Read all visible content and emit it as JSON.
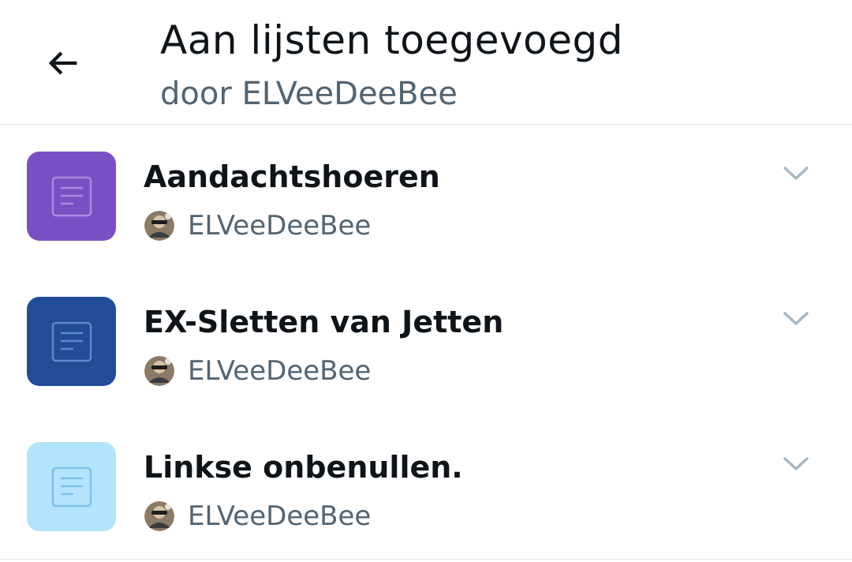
{
  "header": {
    "back_icon": "arrow-left-icon",
    "title": "Aan lijsten toegevoegd",
    "subtitle": "door ELVeeDeeBee"
  },
  "lists": [
    {
      "name": "Aandachtshoeren",
      "owner": "ELVeeDeeBee",
      "tile_color": "#7b4fc4",
      "icon_color": "#a98be0",
      "icon": "list-document-icon"
    },
    {
      "name": "EX-Sletten van Jetten",
      "owner": "ELVeeDeeBee",
      "tile_color": "#204d96",
      "icon_color": "#5b86cc",
      "icon": "list-document-icon"
    },
    {
      "name": "Linkse onbenullen.",
      "owner": "ELVeeDeeBee",
      "tile_color": "#b3e4fb",
      "icon_color": "#7ec2ea",
      "icon": "list-document-icon"
    }
  ],
  "colors": {
    "text_primary": "#0f1419",
    "text_secondary": "#536471",
    "divider": "#dfe3e6",
    "chevron": "#aab8c2"
  }
}
